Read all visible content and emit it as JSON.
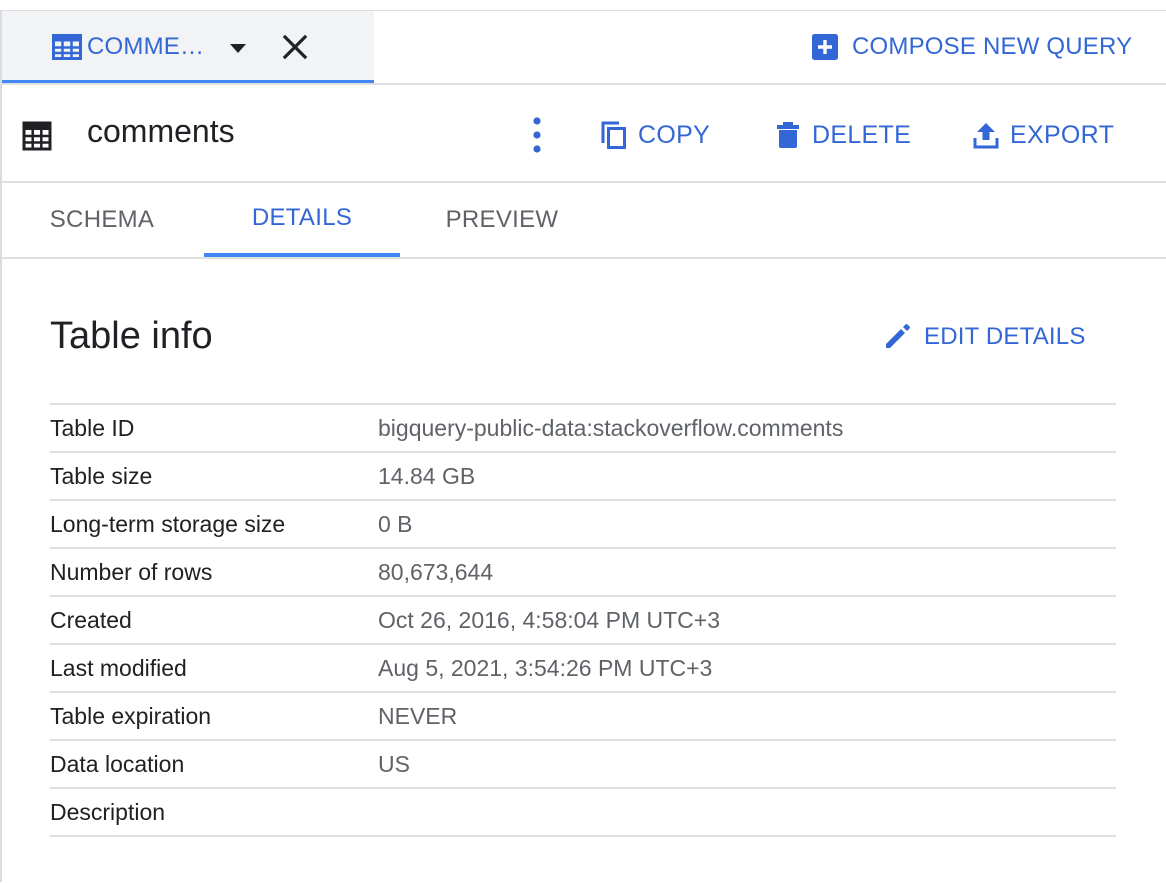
{
  "query_tab": {
    "label": "COMME…",
    "icon": "table-icon"
  },
  "compose": {
    "label": "COMPOSE NEW QUERY",
    "icon": "add-box-icon"
  },
  "resource": {
    "title": "comments",
    "icon": "table-icon"
  },
  "actions": {
    "copy": "COPY",
    "delete": "DELETE",
    "export": "EXPORT"
  },
  "tabs": [
    {
      "label": "SCHEMA",
      "active": false
    },
    {
      "label": "DETAILS",
      "active": true
    },
    {
      "label": "PREVIEW",
      "active": false
    }
  ],
  "table_info": {
    "title": "Table info",
    "edit_label": "EDIT DETAILS",
    "rows": [
      {
        "key": "Table ID",
        "value": "bigquery-public-data:stackoverflow.comments"
      },
      {
        "key": "Table size",
        "value": "14.84 GB"
      },
      {
        "key": "Long-term storage size",
        "value": "0 B"
      },
      {
        "key": "Number of rows",
        "value": "80,673,644"
      },
      {
        "key": "Created",
        "value": "Oct 26, 2016, 4:58:04 PM UTC+3"
      },
      {
        "key": "Last modified",
        "value": "Aug 5, 2021, 3:54:26 PM UTC+3"
      },
      {
        "key": "Table expiration",
        "value": "NEVER"
      },
      {
        "key": "Data location",
        "value": "US"
      },
      {
        "key": "Description",
        "value": ""
      }
    ]
  },
  "colors": {
    "accent": "#3367d6",
    "tab_indicator": "#4285f4",
    "divider": "#e0e0e0",
    "secondary_text": "#5f6368"
  }
}
